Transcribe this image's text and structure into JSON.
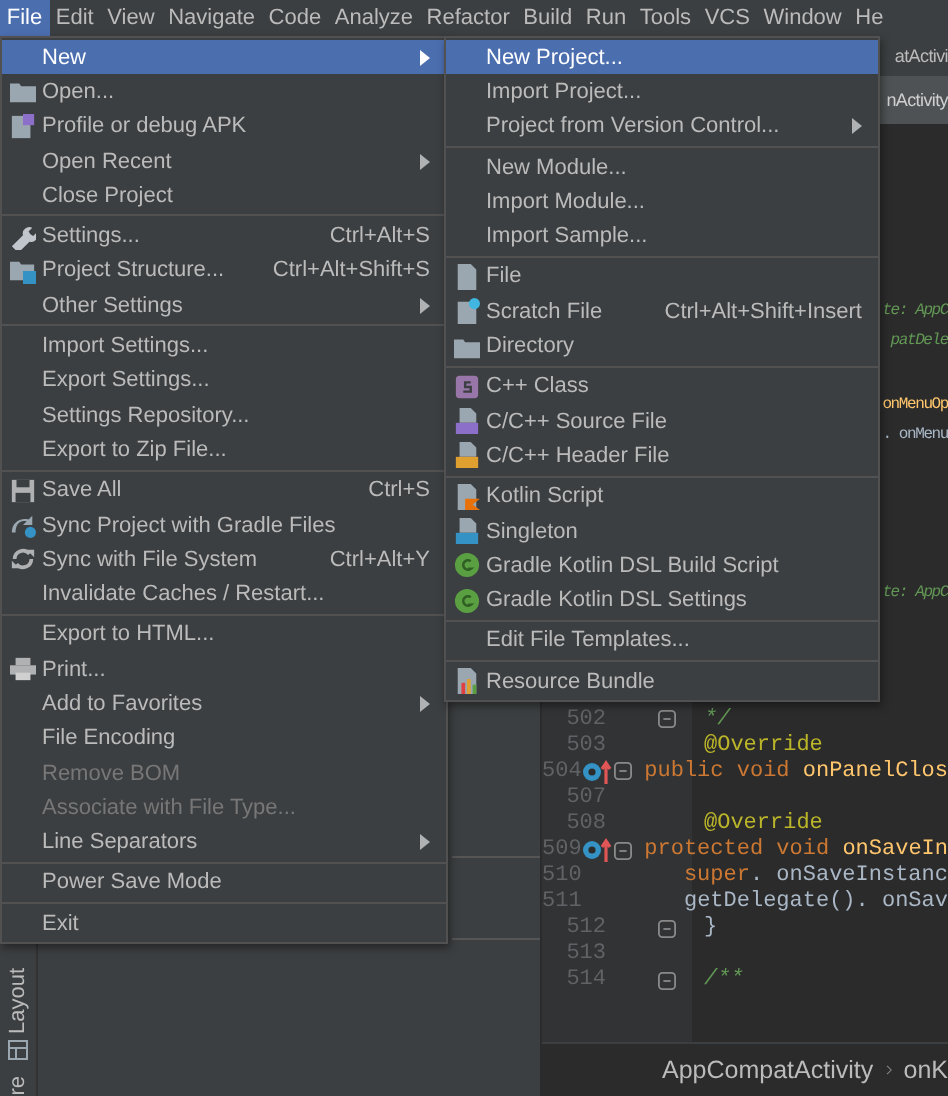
{
  "menubar": [
    {
      "label": "File",
      "selected": true
    },
    {
      "label": "Edit",
      "selected": false
    },
    {
      "label": "View",
      "selected": false
    },
    {
      "label": "Navigate",
      "selected": false
    },
    {
      "label": "Code",
      "selected": false
    },
    {
      "label": "Analyze",
      "selected": false
    },
    {
      "label": "Refactor",
      "selected": false
    },
    {
      "label": "Build",
      "selected": false
    },
    {
      "label": "Run",
      "selected": false
    },
    {
      "label": "Tools",
      "selected": false
    },
    {
      "label": "VCS",
      "selected": false
    },
    {
      "label": "Window",
      "selected": false
    },
    {
      "label": "He",
      "selected": false
    }
  ],
  "editor_tabs": [
    {
      "label": "atActivi",
      "selected": false
    },
    {
      "label": "nActivity",
      "selected": true
    }
  ],
  "code_fragments": [
    [
      {
        "text": "te: AppC",
        "kind": "comment"
      },
      {
        "text": "patDele",
        "kind": "comment"
      }
    ],
    [
      {
        "text": "onMenuOp",
        "kind": "method"
      },
      {
        "text": ". onMenu",
        "kind": "plain"
      }
    ],
    [
      {
        "text": "te: AppC",
        "kind": "comment"
      }
    ]
  ],
  "code_lines": [
    {
      "number": "502",
      "fold": true,
      "override": false,
      "tokens": [
        {
          "text": "*/",
          "kind": "comment"
        }
      ]
    },
    {
      "number": "503",
      "fold": false,
      "override": false,
      "tokens": [
        {
          "text": "@Override",
          "kind": "annotation"
        }
      ]
    },
    {
      "number": "504",
      "fold": true,
      "override": true,
      "tokens": [
        {
          "text": "public void ",
          "kind": "keyword"
        },
        {
          "text": "onPanelClos",
          "kind": "method"
        }
      ]
    },
    {
      "number": "507",
      "fold": false,
      "override": false
    },
    {
      "number": "508",
      "fold": false,
      "override": false,
      "tokens": [
        {
          "text": "@Override",
          "kind": "annotation"
        }
      ]
    },
    {
      "number": "509",
      "fold": true,
      "override": true,
      "tokens": [
        {
          "text": "protected void ",
          "kind": "keyword"
        },
        {
          "text": "onSaveIn",
          "kind": "method"
        }
      ]
    },
    {
      "number": "510",
      "fold": false,
      "override": false,
      "tokens": [
        {
          "text": "super",
          "kind": "keyword",
          "indent": true
        },
        {
          "text": ". onSaveInstanc",
          "kind": "plain"
        }
      ]
    },
    {
      "number": "511",
      "fold": false,
      "override": false,
      "tokens": [
        {
          "text": "getDelegate(). onSav",
          "kind": "plain",
          "indent": true
        }
      ]
    },
    {
      "number": "512",
      "fold": true,
      "override": false,
      "tokens": [
        {
          "text": "}",
          "kind": "plain"
        }
      ]
    },
    {
      "number": "513",
      "fold": false,
      "override": false
    },
    {
      "number": "514",
      "fold": true,
      "override": false,
      "tokens": [
        {
          "text": "/**",
          "kind": "comment"
        }
      ]
    }
  ],
  "breadcrumbs": [
    "AppCompatActivity",
    "onK"
  ],
  "tool_tabs": [
    "Layout",
    "re"
  ],
  "file_menu": [
    {
      "kind": "item",
      "label": "New",
      "submenu": true,
      "selected": true,
      "disabled": false
    },
    {
      "kind": "item",
      "label": "Open...",
      "submenu": false,
      "selected": false,
      "disabled": false
    },
    {
      "kind": "item",
      "label": "Profile or debug APK",
      "submenu": false,
      "selected": false,
      "disabled": false
    },
    {
      "kind": "item",
      "label": "Open Recent",
      "submenu": true,
      "selected": false,
      "disabled": false
    },
    {
      "kind": "item",
      "label": "Close Project",
      "submenu": false,
      "selected": false,
      "disabled": false
    },
    {
      "kind": "separator"
    },
    {
      "kind": "item",
      "label": "Settings...",
      "shortcut": "Ctrl+Alt+S",
      "submenu": false,
      "selected": false,
      "disabled": false
    },
    {
      "kind": "item",
      "label": "Project Structure...",
      "shortcut": "Ctrl+Alt+Shift+S",
      "submenu": false,
      "selected": false,
      "disabled": false
    },
    {
      "kind": "item",
      "label": "Other Settings",
      "submenu": true,
      "selected": false,
      "disabled": false
    },
    {
      "kind": "separator"
    },
    {
      "kind": "item",
      "label": "Import Settings...",
      "submenu": false,
      "selected": false,
      "disabled": false
    },
    {
      "kind": "item",
      "label": "Export Settings...",
      "submenu": false,
      "selected": false,
      "disabled": false
    },
    {
      "kind": "item",
      "label": "Settings Repository...",
      "submenu": false,
      "selected": false,
      "disabled": false
    },
    {
      "kind": "item",
      "label": "Export to Zip File...",
      "submenu": false,
      "selected": false,
      "disabled": false
    },
    {
      "kind": "separator"
    },
    {
      "kind": "item",
      "label": "Save All",
      "shortcut": "Ctrl+S",
      "submenu": false,
      "selected": false,
      "disabled": false
    },
    {
      "kind": "item",
      "label": "Sync Project with Gradle Files",
      "submenu": false,
      "selected": false,
      "disabled": false
    },
    {
      "kind": "item",
      "label": "Sync with File System",
      "shortcut": "Ctrl+Alt+Y",
      "submenu": false,
      "selected": false,
      "disabled": false
    },
    {
      "kind": "item",
      "label": "Invalidate Caches / Restart...",
      "submenu": false,
      "selected": false,
      "disabled": false
    },
    {
      "kind": "separator"
    },
    {
      "kind": "item",
      "label": "Export to HTML...",
      "submenu": false,
      "selected": false,
      "disabled": false
    },
    {
      "kind": "item",
      "label": "Print...",
      "submenu": false,
      "selected": false,
      "disabled": false
    },
    {
      "kind": "item",
      "label": "Add to Favorites",
      "submenu": true,
      "selected": false,
      "disabled": false
    },
    {
      "kind": "item",
      "label": "File Encoding",
      "submenu": false,
      "selected": false,
      "disabled": false
    },
    {
      "kind": "item",
      "label": "Remove BOM",
      "submenu": false,
      "selected": false,
      "disabled": true
    },
    {
      "kind": "item",
      "label": "Associate with File Type...",
      "submenu": false,
      "selected": false,
      "disabled": true
    },
    {
      "kind": "item",
      "label": "Line Separators",
      "submenu": true,
      "selected": false,
      "disabled": false
    },
    {
      "kind": "separator"
    },
    {
      "kind": "item",
      "label": "Power Save Mode",
      "submenu": false,
      "selected": false,
      "disabled": false
    },
    {
      "kind": "separator"
    },
    {
      "kind": "item",
      "label": "Exit",
      "submenu": false,
      "selected": false,
      "disabled": false
    }
  ],
  "new_submenu": [
    {
      "kind": "item",
      "label": "New Project...",
      "submenu": false,
      "selected": true,
      "disabled": false
    },
    {
      "kind": "item",
      "label": "Import Project...",
      "submenu": false,
      "selected": false,
      "disabled": false
    },
    {
      "kind": "item",
      "label": "Project from Version Control...",
      "submenu": true,
      "selected": false,
      "disabled": false
    },
    {
      "kind": "separator"
    },
    {
      "kind": "item",
      "label": "New Module...",
      "submenu": false,
      "selected": false,
      "disabled": false
    },
    {
      "kind": "item",
      "label": "Import Module...",
      "submenu": false,
      "selected": false,
      "disabled": false
    },
    {
      "kind": "item",
      "label": "Import Sample...",
      "submenu": false,
      "selected": false,
      "disabled": false
    },
    {
      "kind": "separator"
    },
    {
      "kind": "item",
      "label": "File",
      "submenu": false,
      "selected": false,
      "disabled": false
    },
    {
      "kind": "item",
      "label": "Scratch File",
      "shortcut": "Ctrl+Alt+Shift+Insert",
      "submenu": false,
      "selected": false,
      "disabled": false
    },
    {
      "kind": "item",
      "label": "Directory",
      "submenu": false,
      "selected": false,
      "disabled": false
    },
    {
      "kind": "separator"
    },
    {
      "kind": "item",
      "label": "C++ Class",
      "submenu": false,
      "selected": false,
      "disabled": false
    },
    {
      "kind": "item",
      "label": "C/C++ Source File",
      "submenu": false,
      "selected": false,
      "disabled": false
    },
    {
      "kind": "item",
      "label": "C/C++ Header File",
      "submenu": false,
      "selected": false,
      "disabled": false
    },
    {
      "kind": "separator"
    },
    {
      "kind": "item",
      "label": "Kotlin Script",
      "submenu": false,
      "selected": false,
      "disabled": false
    },
    {
      "kind": "item",
      "label": "Singleton",
      "submenu": false,
      "selected": false,
      "disabled": false
    },
    {
      "kind": "item",
      "label": "Gradle Kotlin DSL Build Script",
      "submenu": false,
      "selected": false,
      "disabled": false
    },
    {
      "kind": "item",
      "label": "Gradle Kotlin DSL Settings",
      "submenu": false,
      "selected": false,
      "disabled": false
    },
    {
      "kind": "separator"
    },
    {
      "kind": "item",
      "label": "Edit File Templates...",
      "submenu": false,
      "selected": false,
      "disabled": false
    },
    {
      "kind": "separator"
    },
    {
      "kind": "item",
      "label": "Resource Bundle",
      "submenu": false,
      "selected": false,
      "disabled": false
    }
  ]
}
